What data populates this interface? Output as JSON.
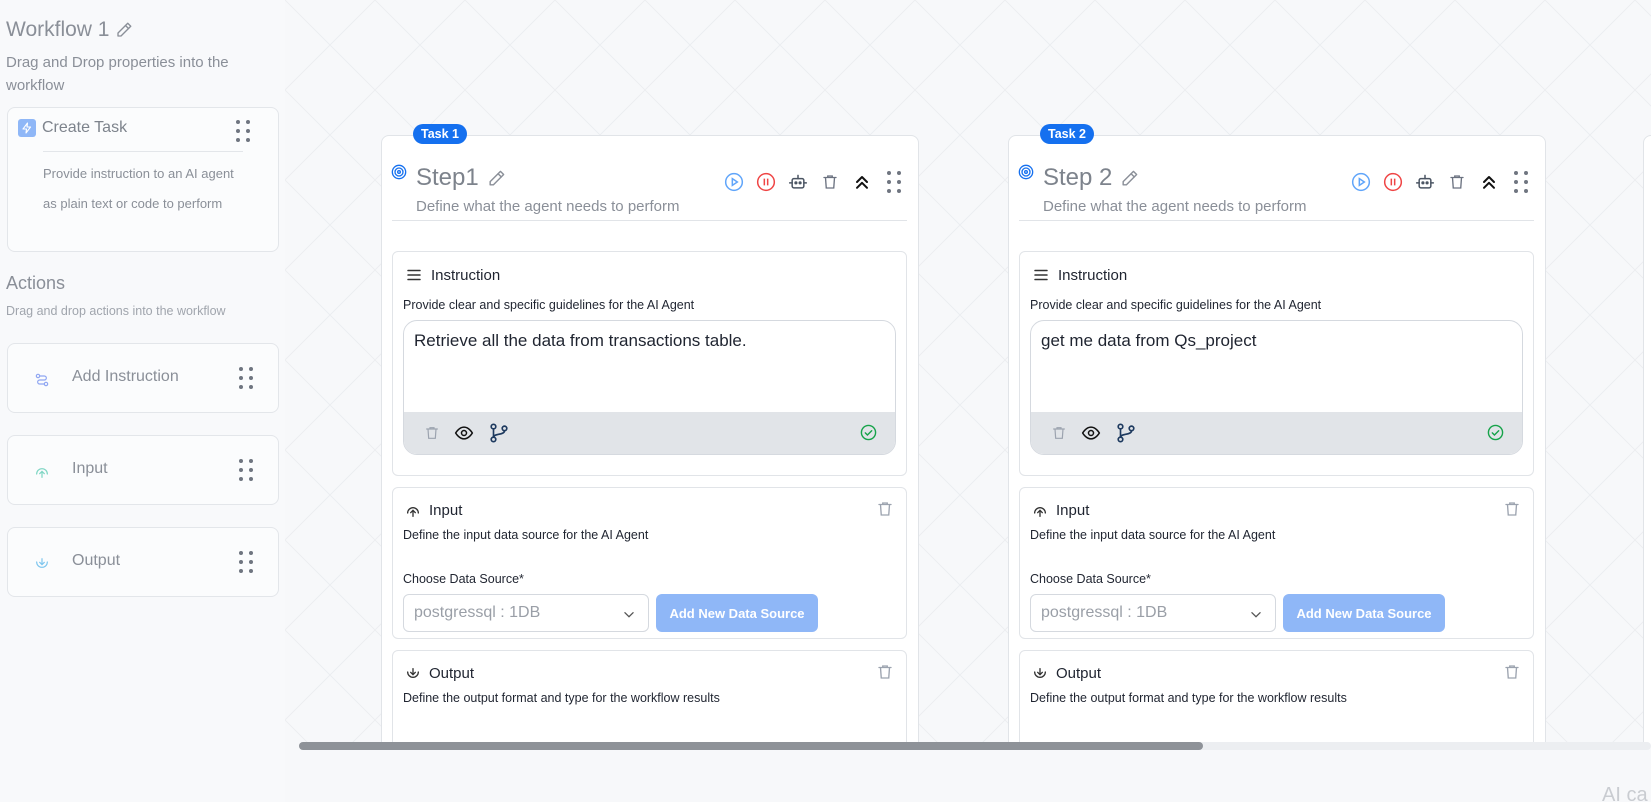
{
  "workflow": {
    "title": "Workflow 1",
    "subtitle": "Drag and Drop properties into the workflow"
  },
  "create_task": {
    "label": "Create Task",
    "description": "Provide instruction to an AI agent as plain text or code to perform"
  },
  "actions": {
    "title": "Actions",
    "subtitle": "Drag and drop actions into the workflow",
    "items": [
      {
        "label": "Add Instruction",
        "icon": "route-icon"
      },
      {
        "label": "Input",
        "icon": "upload-circle-icon"
      },
      {
        "label": "Output",
        "icon": "download-circle-icon"
      }
    ]
  },
  "tasks": [
    {
      "badge": "Task 1",
      "title": "Step1",
      "subtitle": "Define what the agent needs to perform",
      "instruction": {
        "title": "Instruction",
        "description": "Provide clear and specific guidelines for the AI Agent",
        "text": "Retrieve all the data from transactions table."
      },
      "input": {
        "title": "Input",
        "description": "Define the input data source for the AI Agent",
        "source_label": "Choose Data Source*",
        "source_value": "postgressql : 1DB",
        "add_button": "Add New Data Source"
      },
      "output": {
        "title": "Output",
        "description": "Define the output format and type for the workflow results"
      }
    },
    {
      "badge": "Task 2",
      "title": "Step 2",
      "subtitle": "Define what the agent needs to perform",
      "instruction": {
        "title": "Instruction",
        "description": "Provide clear and specific guidelines for the AI Agent",
        "text": "get me data from Qs_project"
      },
      "input": {
        "title": "Input",
        "description": "Define the input data source for the AI Agent",
        "source_label": "Choose Data Source*",
        "source_value": "postgressql : 1DB",
        "add_button": "Add New Data Source"
      },
      "output": {
        "title": "Output",
        "description": "Define the output format and type for the workflow results"
      }
    }
  ],
  "footer_text": "AI ca",
  "colors": {
    "accent": "#1570ef",
    "button_disabled": "#8fb7f7",
    "success": "#16a34a",
    "danger": "#ef4444"
  }
}
